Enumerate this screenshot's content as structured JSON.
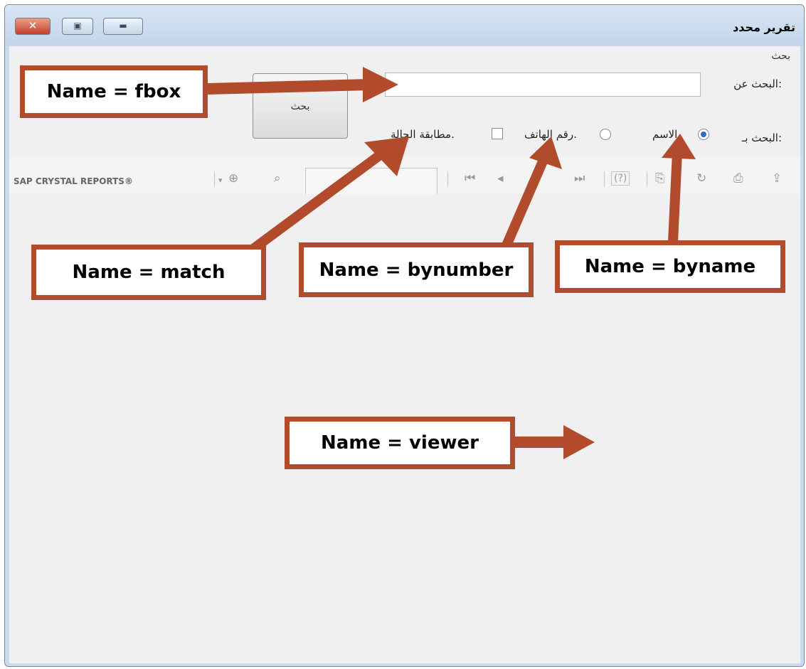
{
  "window": {
    "title": "تقرير محدد"
  },
  "search_group": {
    "title": "بحث",
    "search_for_label": "البحث عن:",
    "search_button_label": "بحث",
    "search_by_label": "البحث بـ:",
    "options": {
      "by_name": {
        "label": "الاسم.",
        "checked": true
      },
      "by_number": {
        "label": "رقم الهاتف.",
        "checked": false
      },
      "match_case": {
        "label": "مطابقة الحالة.",
        "checked": false
      }
    }
  },
  "toolbar": {
    "brand": "SAP CRYSTAL REPORTS®"
  },
  "annotations": {
    "fbox": "Name = fbox",
    "match": "Name = match",
    "bynumber": "Name = bynumber",
    "byname": "Name = byname",
    "viewer": "Name = viewer"
  },
  "colors": {
    "annotation": "#b24a2c",
    "window_frame": "#c9dbee"
  }
}
